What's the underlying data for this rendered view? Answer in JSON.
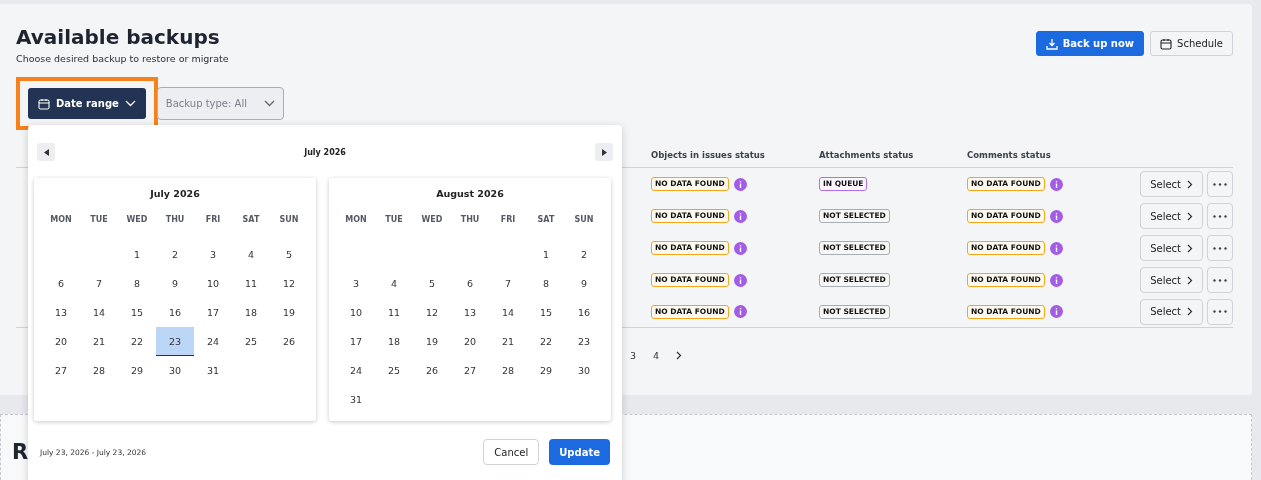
{
  "header": {
    "title": "Available backups",
    "subtitle": "Choose desired backup to restore or migrate",
    "actions": [
      {
        "label": "Back up now",
        "kind": "primary"
      },
      {
        "label": "Schedule",
        "kind": "secondary"
      }
    ]
  },
  "filters": {
    "date_range": {
      "label": "Date range",
      "highlighted": true
    },
    "backup_type": {
      "label": "Backup type: All"
    }
  },
  "table": {
    "columns": [
      "Objects in issues status",
      "Attachments status",
      "Comments status"
    ],
    "rows": [
      {
        "cells": [
          {
            "label": "NO DATA FOUND",
            "kind": "warning",
            "info": true
          },
          {
            "label": "IN QUEUE",
            "kind": "queue",
            "info": false
          },
          {
            "label": "NO DATA FOUND",
            "kind": "warning",
            "info": true
          }
        ],
        "action": "Select"
      },
      {
        "cells": [
          {
            "label": "NO DATA FOUND",
            "kind": "warning",
            "info": true
          },
          {
            "label": "NOT SELECTED",
            "kind": "neutral",
            "info": false
          },
          {
            "label": "NO DATA FOUND",
            "kind": "warning",
            "info": true
          }
        ],
        "action": "Select"
      },
      {
        "cells": [
          {
            "label": "NO DATA FOUND",
            "kind": "warning",
            "info": true
          },
          {
            "label": "NOT SELECTED",
            "kind": "neutral",
            "info": false
          },
          {
            "label": "NO DATA FOUND",
            "kind": "warning",
            "info": true
          }
        ],
        "action": "Select"
      },
      {
        "cells": [
          {
            "label": "NO DATA FOUND",
            "kind": "warning",
            "info": true
          },
          {
            "label": "NOT SELECTED",
            "kind": "neutral",
            "info": false
          },
          {
            "label": "NO DATA FOUND",
            "kind": "warning",
            "info": true
          }
        ],
        "action": "Select"
      },
      {
        "cells": [
          {
            "label": "NO DATA FOUND",
            "kind": "warning",
            "info": true
          },
          {
            "label": "NOT SELECTED",
            "kind": "neutral",
            "info": false
          },
          {
            "label": "NO DATA FOUND",
            "kind": "warning",
            "info": true
          }
        ],
        "action": "Select"
      }
    ]
  },
  "pagination": {
    "pages": [
      {
        "label": "3",
        "selected": false
      },
      {
        "label": "4",
        "selected": false
      }
    ]
  },
  "second_section": {
    "title": "R"
  },
  "date_picker": {
    "nav_title": "July 2026",
    "months": [
      {
        "title": "July 2026",
        "weekdays": [
          "MON",
          "TUE",
          "WED",
          "THU",
          "FRI",
          "SAT",
          "SUN"
        ],
        "weeks": [
          [
            {
              "label": "1",
              "selected": false
            },
            {
              "label": "2",
              "selected": false
            },
            {
              "label": "3",
              "selected": false
            },
            {
              "label": "4",
              "selected": false
            },
            {
              "label": "5",
              "selected": false
            }
          ],
          [
            {
              "label": "6",
              "selected": false
            },
            {
              "label": "7",
              "selected": false
            },
            {
              "label": "8",
              "selected": false
            },
            {
              "label": "9",
              "selected": false
            },
            {
              "label": "10",
              "selected": false
            },
            {
              "label": "11",
              "selected": false
            },
            {
              "label": "12",
              "selected": false
            }
          ],
          [
            {
              "label": "13",
              "selected": false
            },
            {
              "label": "14",
              "selected": false
            },
            {
              "label": "15",
              "selected": false
            },
            {
              "label": "16",
              "selected": false
            },
            {
              "label": "17",
              "selected": false
            },
            {
              "label": "18",
              "selected": false
            },
            {
              "label": "19",
              "selected": false
            }
          ],
          [
            {
              "label": "20",
              "selected": false
            },
            {
              "label": "21",
              "selected": false
            },
            {
              "label": "22",
              "selected": false
            },
            {
              "label": "23",
              "selected": true
            },
            {
              "label": "24",
              "selected": false
            },
            {
              "label": "25",
              "selected": false
            },
            {
              "label": "26",
              "selected": false
            }
          ],
          [
            {
              "label": "27",
              "selected": false
            },
            {
              "label": "28",
              "selected": false
            },
            {
              "label": "29",
              "selected": false
            },
            {
              "label": "30",
              "selected": false
            },
            {
              "label": "31",
              "selected": false
            }
          ]
        ]
      },
      {
        "title": "August 2026",
        "weekdays": [
          "MON",
          "TUE",
          "WED",
          "THU",
          "FRI",
          "SAT",
          "SUN"
        ],
        "weeks": [
          [
            {
              "label": "1",
              "selected": false
            },
            {
              "label": "2",
              "selected": false
            }
          ],
          [
            {
              "label": "3",
              "selected": false
            },
            {
              "label": "4",
              "selected": false
            },
            {
              "label": "5",
              "selected": false
            },
            {
              "label": "6",
              "selected": false
            },
            {
              "label": "7",
              "selected": false
            },
            {
              "label": "8",
              "selected": false
            },
            {
              "label": "9",
              "selected": false
            }
          ],
          [
            {
              "label": "10",
              "selected": false
            },
            {
              "label": "11",
              "selected": false
            },
            {
              "label": "12",
              "selected": false
            },
            {
              "label": "13",
              "selected": false
            },
            {
              "label": "14",
              "selected": false
            },
            {
              "label": "15",
              "selected": false
            },
            {
              "label": "16",
              "selected": false
            }
          ],
          [
            {
              "label": "17",
              "selected": false
            },
            {
              "label": "18",
              "selected": false
            },
            {
              "label": "19",
              "selected": false
            },
            {
              "label": "20",
              "selected": false
            },
            {
              "label": "21",
              "selected": false
            },
            {
              "label": "22",
              "selected": false
            },
            {
              "label": "23",
              "selected": false
            }
          ],
          [
            {
              "label": "24",
              "selected": false
            },
            {
              "label": "25",
              "selected": false
            },
            {
              "label": "26",
              "selected": false
            },
            {
              "label": "27",
              "selected": false
            },
            {
              "label": "28",
              "selected": false
            },
            {
              "label": "29",
              "selected": false
            },
            {
              "label": "30",
              "selected": false
            }
          ],
          [
            {
              "label": "31",
              "selected": false
            }
          ]
        ]
      }
    ],
    "range_text": "July 23, 2026 - July 23, 2026",
    "cancel": "Cancel",
    "update": "Update"
  }
}
